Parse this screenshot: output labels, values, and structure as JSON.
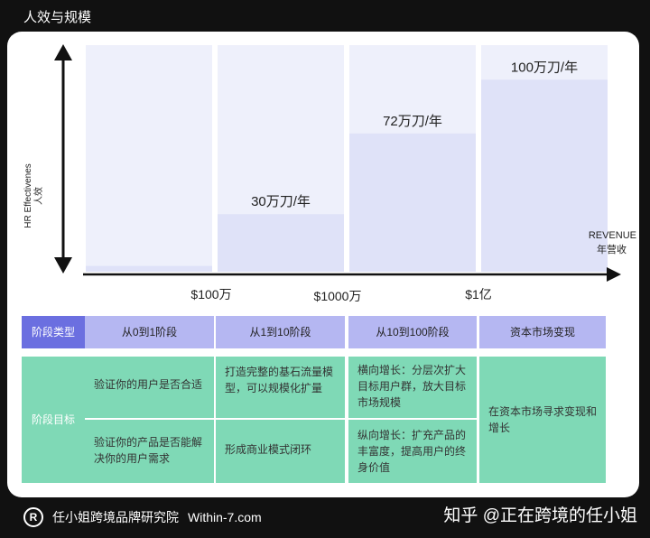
{
  "page_title": "人效与规模",
  "chart_data": {
    "type": "bar",
    "ylabel": [
      "HR Effectivenes",
      "人效"
    ],
    "xlabel": [
      "REVENUE",
      "年营收"
    ],
    "x_ticks": [
      "$100万",
      "$1000万",
      "$1亿"
    ],
    "categories": [
      "从0到1阶段",
      "从1到10阶段",
      "从10到100阶段",
      "资本市场变现"
    ],
    "values": [
      3,
      30,
      72,
      100
    ],
    "data_labels": [
      "",
      "30万刀/年",
      "72万刀/年",
      "100万刀/年"
    ],
    "ylim": [
      0,
      118
    ]
  },
  "table": {
    "row1_header": "阶段类型",
    "stages": [
      "从0到1阶段",
      "从1到10阶段",
      "从10到100阶段",
      "资本市场变现"
    ],
    "row2_header": "阶段目标",
    "goals": {
      "c1_top": "验证你的用户是否合适",
      "c1_bottom": "验证你的产品是否能解决你的用户需求",
      "c2_top": "打造完整的基石流量模型，可以规模化扩量",
      "c2_bottom": "形成商业模式闭环",
      "c3_top": "横向增长：分层次扩大目标用户群，放大目标市场规模",
      "c3_bottom": "纵向增长：扩充产品的丰富度，提高用户的终身价值",
      "c4": "在资本市场寻求变现和增长"
    }
  },
  "footer": {
    "logo_letter": "R",
    "org": "任小姐跨境品牌研究院",
    "site": "Within-7.com",
    "watermark": "知乎 @正在跨境的任小姐"
  }
}
